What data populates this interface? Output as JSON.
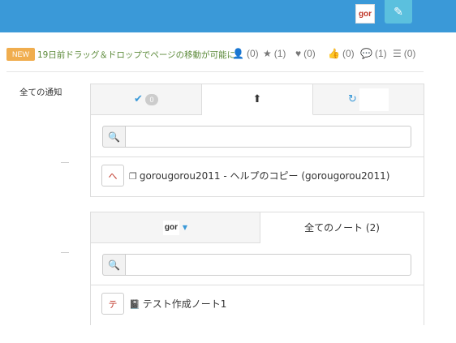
{
  "header": {
    "avatar_text": "gor",
    "edit_icon": "pencil-icon"
  },
  "infobar": {
    "badge": "NEW",
    "text": "19日前ドラッグ＆ドロップでページの移動が可能に",
    "stats": [
      {
        "icon": "user-icon",
        "glyph": "👤",
        "value": "(0)"
      },
      {
        "icon": "star-icon",
        "glyph": "★",
        "value": "(1)"
      },
      {
        "icon": "heart-icon",
        "glyph": "♥",
        "value": "(0)"
      },
      {
        "icon": "thumbs-up-icon",
        "glyph": "👍",
        "value": "(0)"
      },
      {
        "icon": "comments-icon",
        "glyph": "💬",
        "value": "(1)"
      },
      {
        "icon": "list-icon",
        "glyph": "☰",
        "value": "(0)"
      }
    ]
  },
  "sidebar": {
    "label": "全ての通知"
  },
  "notifications_panel": {
    "tabs": [
      {
        "icon": "check-icon",
        "glyph": "✔",
        "badge": "0"
      },
      {
        "icon": "upload-icon",
        "glyph": "⬆"
      },
      {
        "icon": "refresh-icon",
        "glyph": "↻"
      }
    ],
    "search_placeholder": "",
    "item": {
      "thumb": "へ",
      "icon": "copy-icon",
      "text": "gorougorou2011 - ヘルプのコピー (gorougorou2011)"
    }
  },
  "notes_panel": {
    "avatar_text": "gor",
    "tab_label": "全てのノート (2)",
    "search_placeholder": "",
    "item": {
      "thumb": "テ",
      "icon": "book-icon",
      "text": "テスト作成ノート1"
    }
  }
}
